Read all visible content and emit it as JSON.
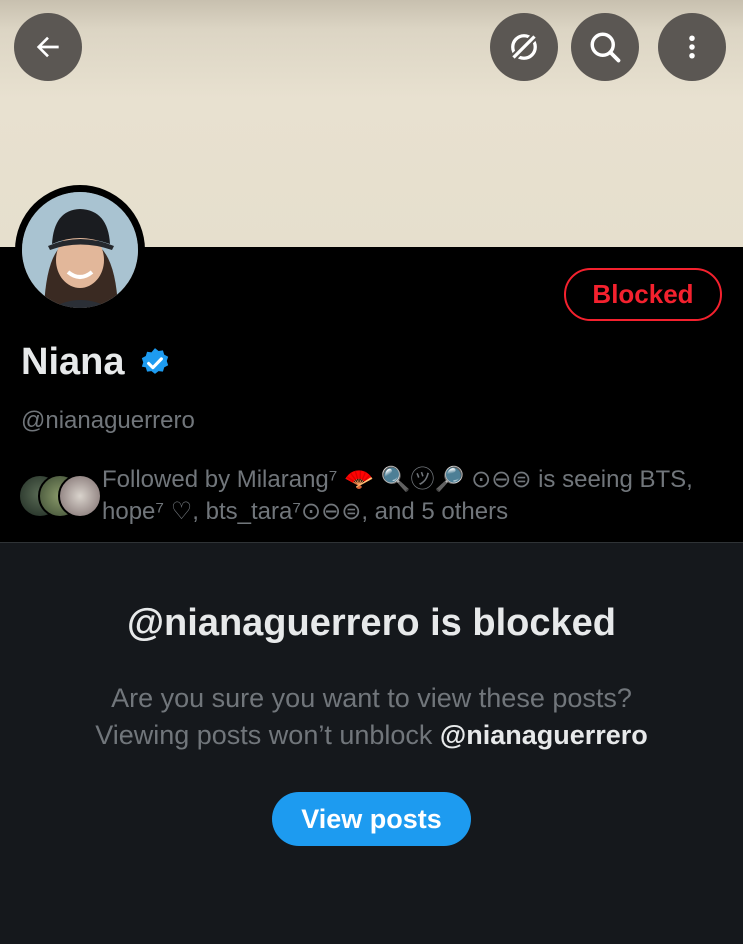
{
  "profile": {
    "name": "Niana",
    "handle": "@nianaguerrero",
    "status_button": "Blocked",
    "followed_by_line1": "Followed by Milarang⁷ 🪭 🔍㋡🔎 ⊙⊖⊜ is seeing BTS,",
    "followed_by_line2": "hope⁷ ♡, bts_tara⁷⊙⊖⊜, and 5 others"
  },
  "blocked_notice": {
    "title": "@nianaguerrero is blocked",
    "line1": "Are you sure you want to view these posts?",
    "line2_prefix": "Viewing posts won’t unblock ",
    "line2_handle": "@nianaguerrero",
    "button": "View posts"
  },
  "icons": {
    "back": "back-arrow-icon",
    "grok": "grok-icon",
    "search": "search-icon",
    "more": "more-vertical-icon",
    "verified": "verified-badge-icon"
  },
  "colors": {
    "accent": "#1d9bf0",
    "blocked_red": "#f4212e",
    "background": "#15181c",
    "header_black": "#000000"
  }
}
